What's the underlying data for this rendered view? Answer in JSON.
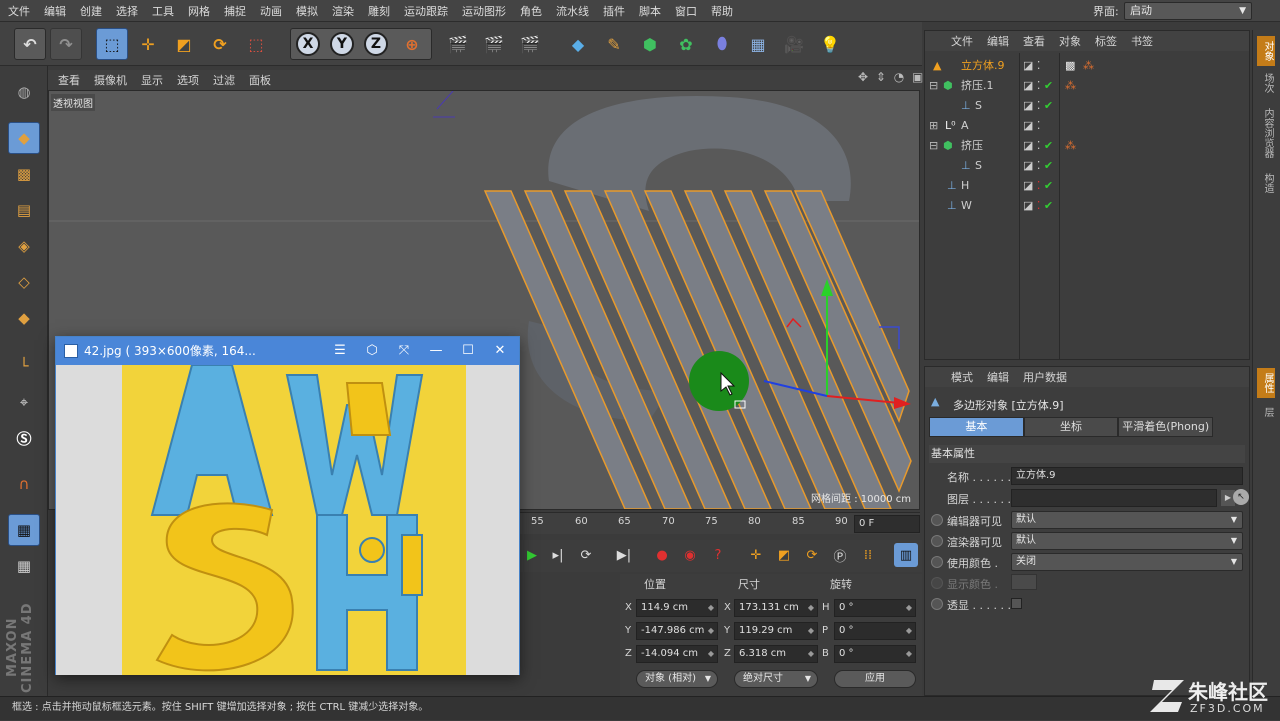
{
  "menubar": {
    "items": [
      "文件",
      "编辑",
      "创建",
      "选择",
      "工具",
      "网格",
      "捕捉",
      "动画",
      "模拟",
      "渲染",
      "雕刻",
      "运动跟踪",
      "运动图形",
      "角色",
      "流水线",
      "插件",
      "脚本",
      "窗口",
      "帮助"
    ],
    "layout_label": "界面:",
    "layout_value": "启动"
  },
  "viewport": {
    "menu": [
      "查看",
      "摄像机",
      "显示",
      "选项",
      "过滤",
      "面板"
    ],
    "label": "透视视图",
    "grid_readout": "网格间距 : 10000 cm"
  },
  "timeline": {
    "ticks": [
      "55",
      "60",
      "65",
      "70",
      "75",
      "80",
      "85",
      "90"
    ],
    "frame": "0 F"
  },
  "coords": {
    "headers": {
      "position": "位置",
      "size": "尺寸",
      "rotation": "旋转"
    },
    "rows": [
      {
        "axis": "X",
        "pos": "114.9 cm",
        "size_axis": "X",
        "size": "173.131 cm",
        "rot_axis": "H",
        "rot": "0 °"
      },
      {
        "axis": "Y",
        "pos": "-147.986 cm",
        "size_axis": "Y",
        "size": "119.29 cm",
        "rot_axis": "P",
        "rot": "0 °"
      },
      {
        "axis": "Z",
        "pos": "-14.094 cm",
        "size_axis": "Z",
        "size": "6.318 cm",
        "rot_axis": "B",
        "rot": "0 °"
      }
    ],
    "mode_select": "对象 (相对)",
    "size_select": "绝对尺寸",
    "apply_label": "应用"
  },
  "objects": {
    "menu": [
      "文件",
      "编辑",
      "查看",
      "对象",
      "标签",
      "书签"
    ],
    "rows": [
      {
        "name": "立方体.9",
        "selected": true
      },
      {
        "name": "挤压.1",
        "selected": false
      },
      {
        "name": "S",
        "selected": false
      },
      {
        "name": "A",
        "selected": false
      },
      {
        "name": "挤压",
        "selected": false
      },
      {
        "name": "S",
        "selected": false
      },
      {
        "name": "H",
        "selected": false
      },
      {
        "name": "W",
        "selected": false
      }
    ]
  },
  "attributes": {
    "menu": [
      "模式",
      "编辑",
      "用户数据"
    ],
    "title": "多边形对象 [立方体.9]",
    "tabs": [
      "基本",
      "坐标",
      "平滑着色(Phong)"
    ],
    "section": "基本属性",
    "name_label": "名称 . . . . . .",
    "name_value": "立方体.9",
    "layer_label": "图层 . . . . . .",
    "editor_label": "编辑器可见",
    "editor_value": "默认",
    "render_label": "渲染器可见",
    "render_value": "默认",
    "usecolor_label": "使用颜色 .",
    "usecolor_value": "关闭",
    "displaycolor_label": "显示颜色 .",
    "xray_label": "透显 . . . . . ."
  },
  "right_strip": [
    "对象",
    "场次",
    "内容浏览器",
    "构造"
  ],
  "right_strip_attr": [
    "属性",
    "层"
  ],
  "image_window": {
    "title": "42.jpg ( 393×600像素, 164..."
  },
  "statusbar": "框选 : 点击并拖动鼠标框选元素。按住 SHIFT 键增加选择对象 ; 按住 CTRL 键减少选择对象。",
  "brand": "MAXON CINEMA 4D",
  "watermark": {
    "title": "朱峰社区",
    "url": "ZF3D.COM"
  },
  "colors": {
    "accent": "#6b9bd6",
    "selection_orange": "#e89a2c",
    "image_bg": "#f2d33a",
    "letters": "#5ab0e0"
  }
}
